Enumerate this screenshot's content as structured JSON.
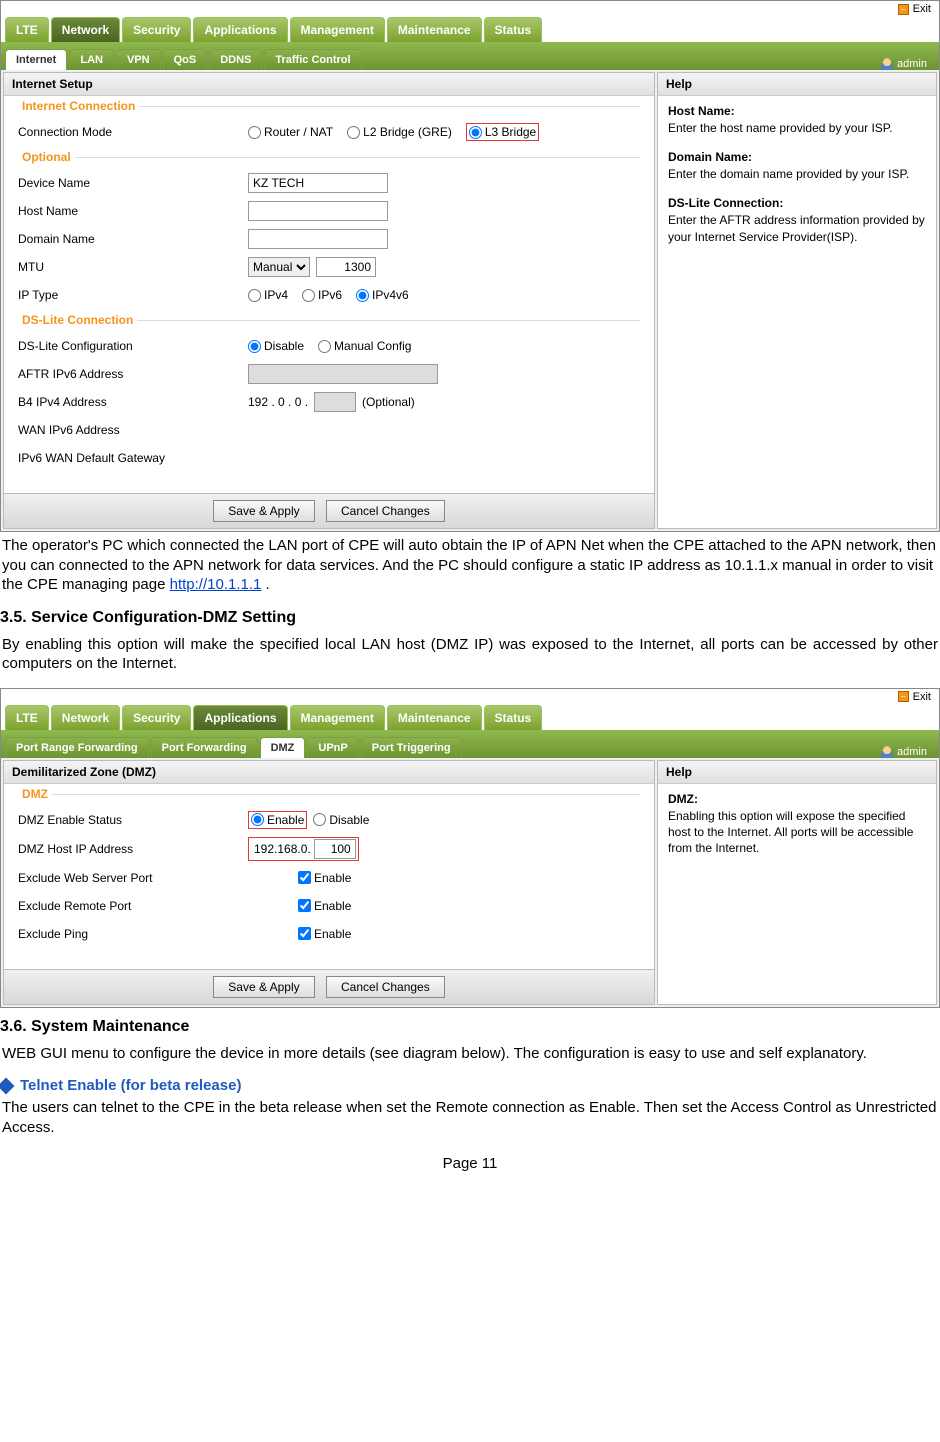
{
  "shot1": {
    "exit": "Exit",
    "admin": "admin",
    "main_tabs": [
      "LTE",
      "Network",
      "Security",
      "Applications",
      "Management",
      "Maintenance",
      "Status"
    ],
    "main_active": 1,
    "sub_tabs": [
      "Internet",
      "LAN",
      "VPN",
      "QoS",
      "DDNS",
      "Traffic Control"
    ],
    "sub_active": 0,
    "panel_title": "Internet  Setup",
    "fs1": {
      "legend": "Internet Connection",
      "conn_mode_label": "Connection Mode",
      "opts": [
        "Router / NAT",
        "L2 Bridge (GRE)",
        "L3 Bridge"
      ],
      "selected": 2
    },
    "fs2": {
      "legend": "Optional",
      "device_name_label": "Device Name",
      "device_name_value": "KZ TECH",
      "host_name_label": "Host Name",
      "domain_name_label": "Domain Name",
      "mtu_label": "MTU",
      "mtu_select": "Manual",
      "mtu_value": "1300",
      "ip_type_label": "IP Type",
      "ip_opts": [
        "IPv4",
        "IPv6",
        "IPv4v6"
      ],
      "ip_selected": 2
    },
    "fs3": {
      "legend": "DS-Lite Connection",
      "dslite_label": "DS-Lite Configuration",
      "dslite_opts": [
        "Disable",
        "Manual Config"
      ],
      "dslite_selected": 0,
      "aftr_label": "AFTR IPv6 Address",
      "b4_label": "B4 IPv4 Address",
      "b4_prefix": "192 . 0 . 0 .",
      "b4_optional": "(Optional)",
      "wan6_label": "WAN IPv6 Address",
      "wan6gw_label": "IPv6 WAN Default Gateway"
    },
    "buttons": {
      "save": "Save & Apply",
      "cancel": "Cancel Changes"
    },
    "help": {
      "title": "Help",
      "items": [
        {
          "h": "Host Name:",
          "p": "Enter the host name provided by your ISP."
        },
        {
          "h": "Domain Name:",
          "p": "Enter the domain name provided by your ISP."
        },
        {
          "h": "DS-Lite Connection:",
          "p": "Enter the AFTR address information provided by your Internet Service Provider(ISP)."
        }
      ]
    }
  },
  "para1_a": "The operator's PC which connected the LAN port of CPE will auto obtain the IP of  APN Net when the CPE attached to the APN network, then you can connected to the APN network for data services.  And the PC should configure a static IP address as 10.1.1.x manual in order to visit the CPE managing page ",
  "para1_link": "http://10.1.1.1",
  "para1_b": " .",
  "heading35": "3.5.    Service Configuration-DMZ Setting",
  "para2": "By enabling this option will make the specified local LAN host (DMZ IP) was exposed to the Internet, all ports can be accessed by other computers on the Internet.",
  "shot2": {
    "exit": "Exit",
    "admin": "admin",
    "main_tabs": [
      "LTE",
      "Network",
      "Security",
      "Applications",
      "Management",
      "Maintenance",
      "Status"
    ],
    "main_active": 3,
    "sub_tabs": [
      "Port Range Forwarding",
      "Port Forwarding",
      "DMZ",
      "UPnP",
      "Port Triggering"
    ],
    "sub_active": 2,
    "panel_title": "Demilitarized Zone (DMZ)",
    "fs1": {
      "legend": "DMZ",
      "status_label": "DMZ Enable Status",
      "status_opts": [
        "Enable",
        "Disable"
      ],
      "status_selected": 0,
      "ip_label": "DMZ Host IP Address",
      "ip_prefix": "192.168.0.",
      "ip_value": "100",
      "ex_web_label": "Exclude Web Server Port",
      "ex_remote_label": "Exclude Remote Port",
      "ex_ping_label": "Exclude Ping",
      "enable_text": "Enable"
    },
    "buttons": {
      "save": "Save & Apply",
      "cancel": "Cancel Changes"
    },
    "help": {
      "title": "Help",
      "items": [
        {
          "h": "DMZ:",
          "p": "Enabling this option will expose the specified host to the Internet. All ports will be accessible from the Internet."
        }
      ]
    }
  },
  "heading36": "3.6.    System Maintenance",
  "para3": "WEB GUI menu to configure the device in more details (see diagram below). The configuration is easy to use and self explanatory.",
  "bullet_heading": "Telnet Enable (for beta release)",
  "para4": "The users can telnet to the CPE in the beta release when set the Remote connection as Enable. Then set the Access Control as Unrestricted Access.",
  "page_num": "Page 11"
}
